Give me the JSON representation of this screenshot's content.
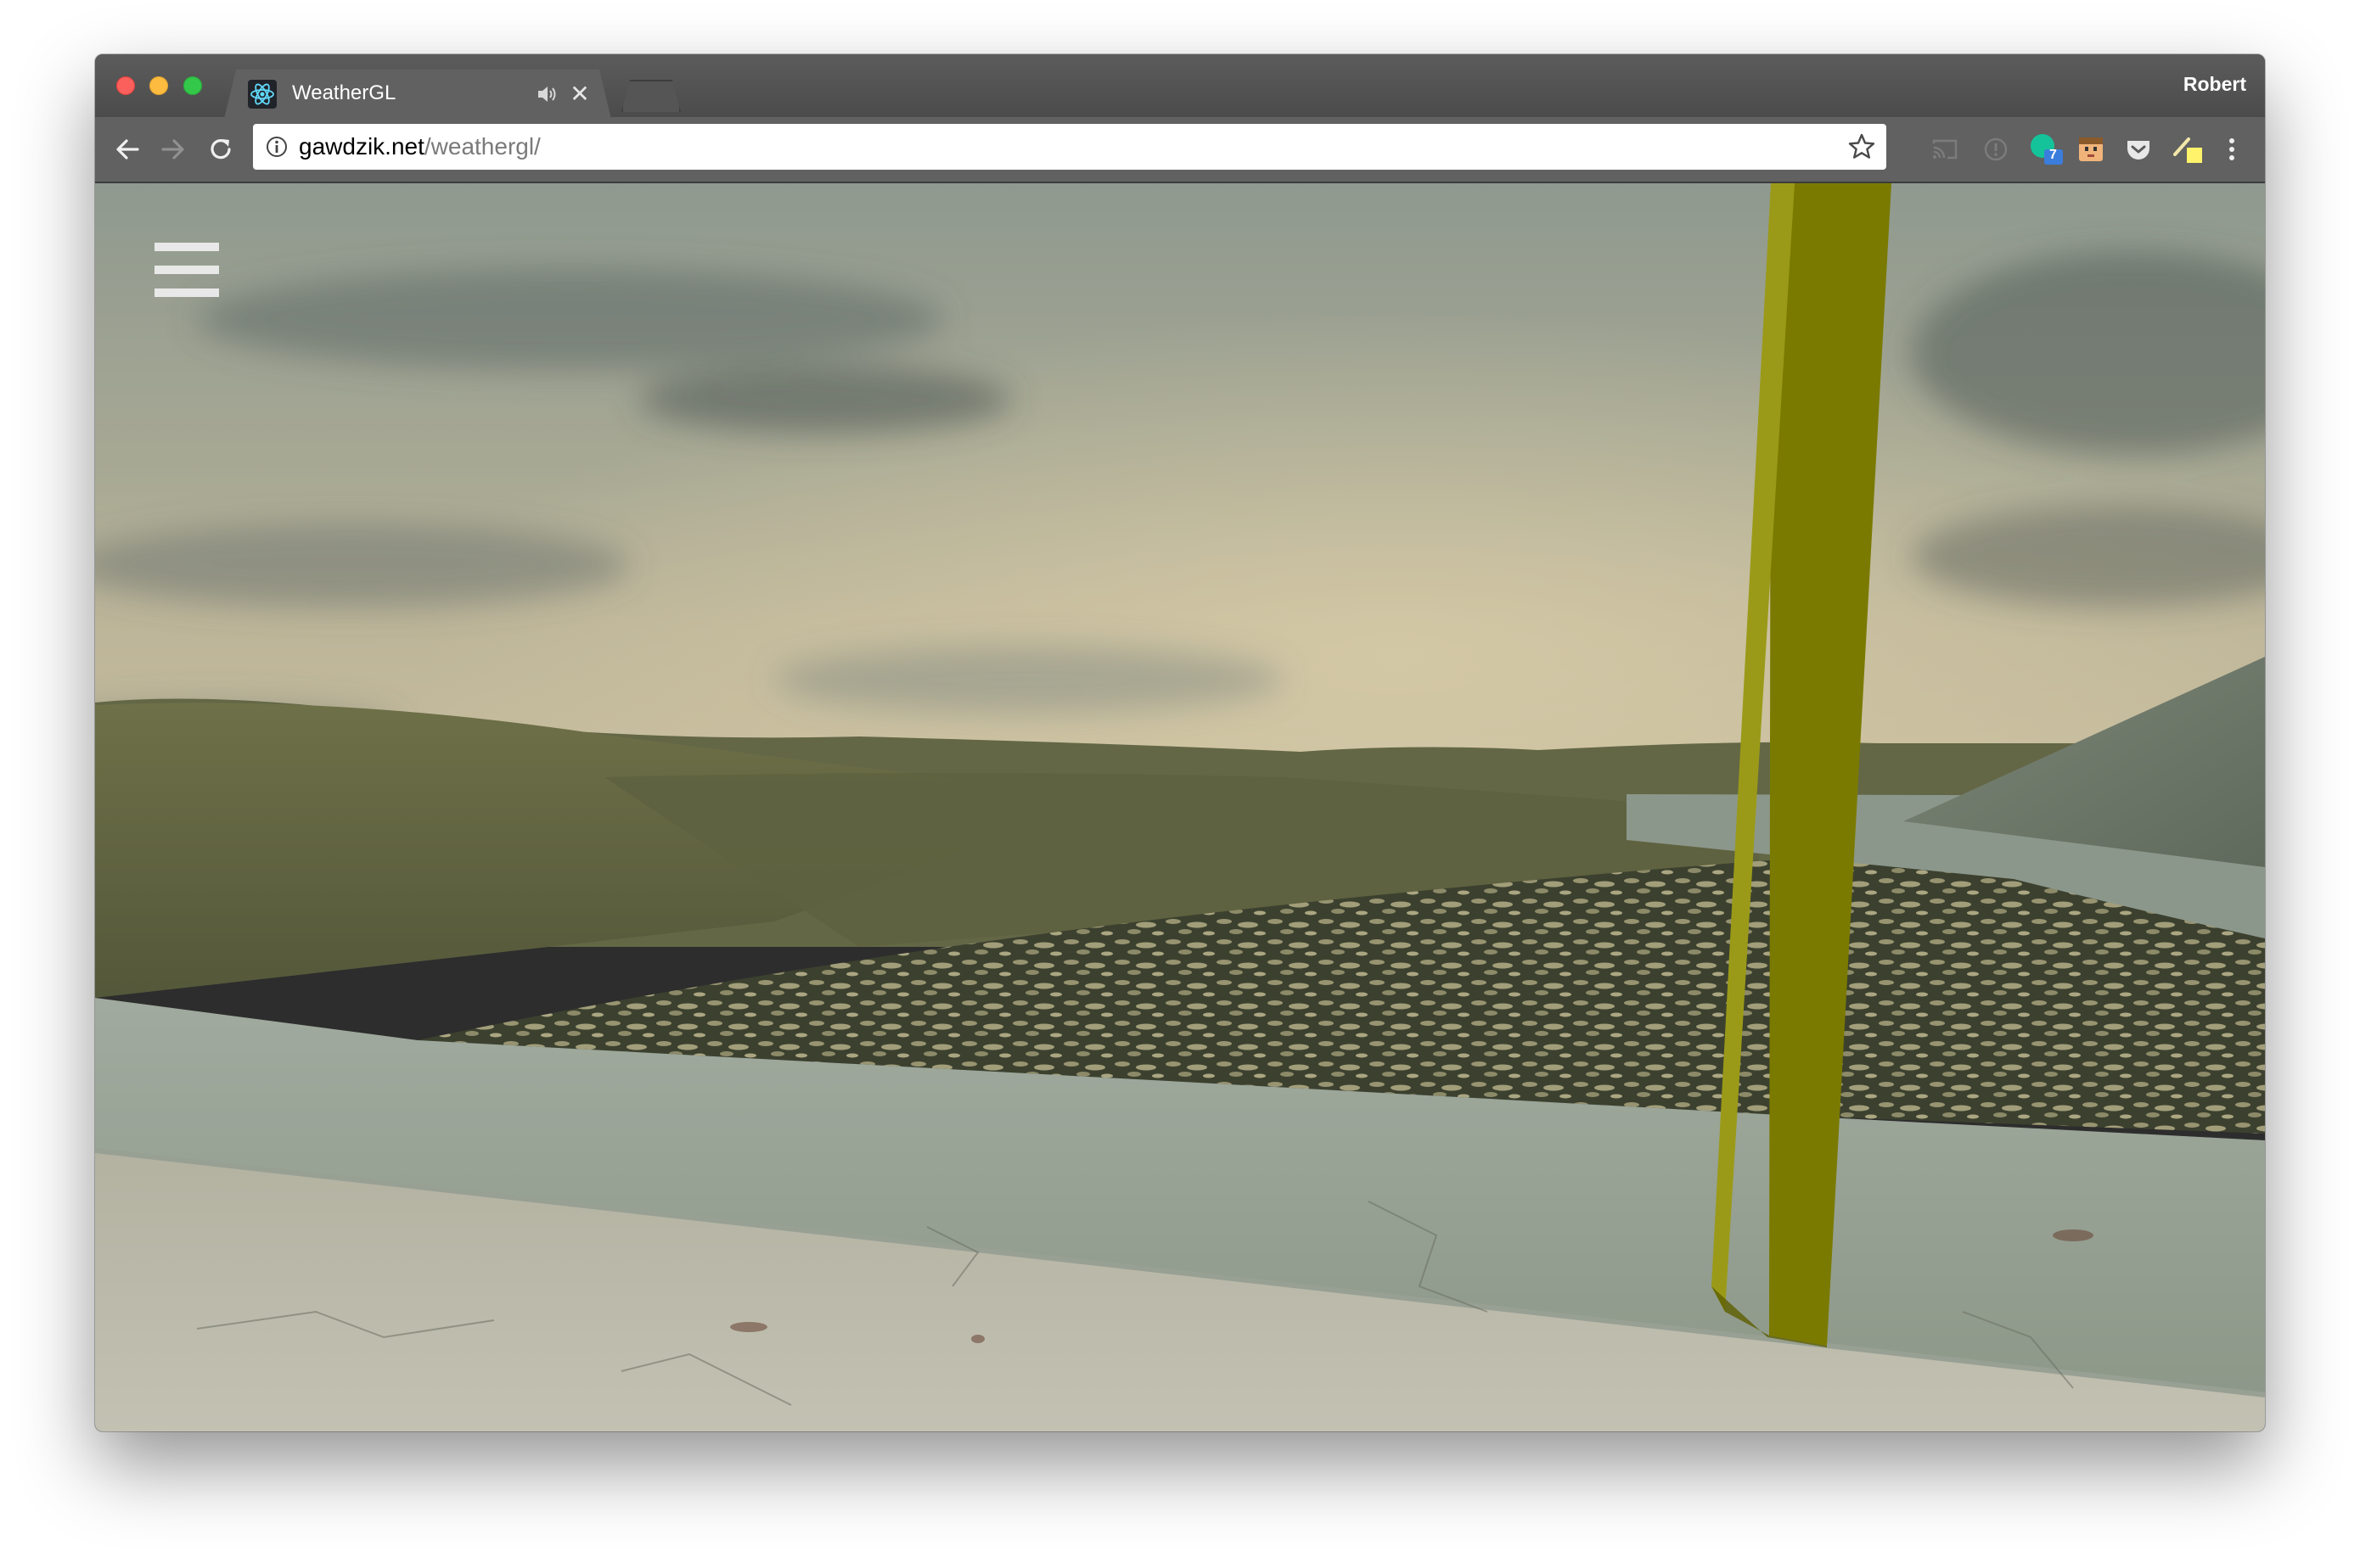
{
  "browser": {
    "tab": {
      "title": "WeatherGL",
      "favicon": "react-atom-icon",
      "audio": "speaker-icon",
      "close": "✕"
    },
    "profile_name": "Robert",
    "nav": {
      "back": "arrow-left-icon",
      "forward": "arrow-right-icon",
      "reload": "reload-icon"
    },
    "omnibox": {
      "url_host": "gawdzik.net",
      "url_path": "/weathergl/",
      "security": "info-icon",
      "bookmark": "star-icon"
    },
    "extensions": [
      {
        "name": "cast-icon"
      },
      {
        "name": "extension-info-icon"
      },
      {
        "name": "grammarly-icon",
        "badge": "7"
      },
      {
        "name": "face-extension-icon"
      },
      {
        "name": "pocket-icon"
      },
      {
        "name": "note-extension-icon"
      }
    ],
    "menu": "more-vertical-icon"
  },
  "page": {
    "menu_icon": "hamburger-menu-icon",
    "scene": "webgl-weather-scene"
  },
  "colors": {
    "chrome_frame": "#4f4f4f",
    "toolbar": "#616161",
    "pillar": "#7a7a00",
    "pillar_light": "#9a9a18"
  }
}
